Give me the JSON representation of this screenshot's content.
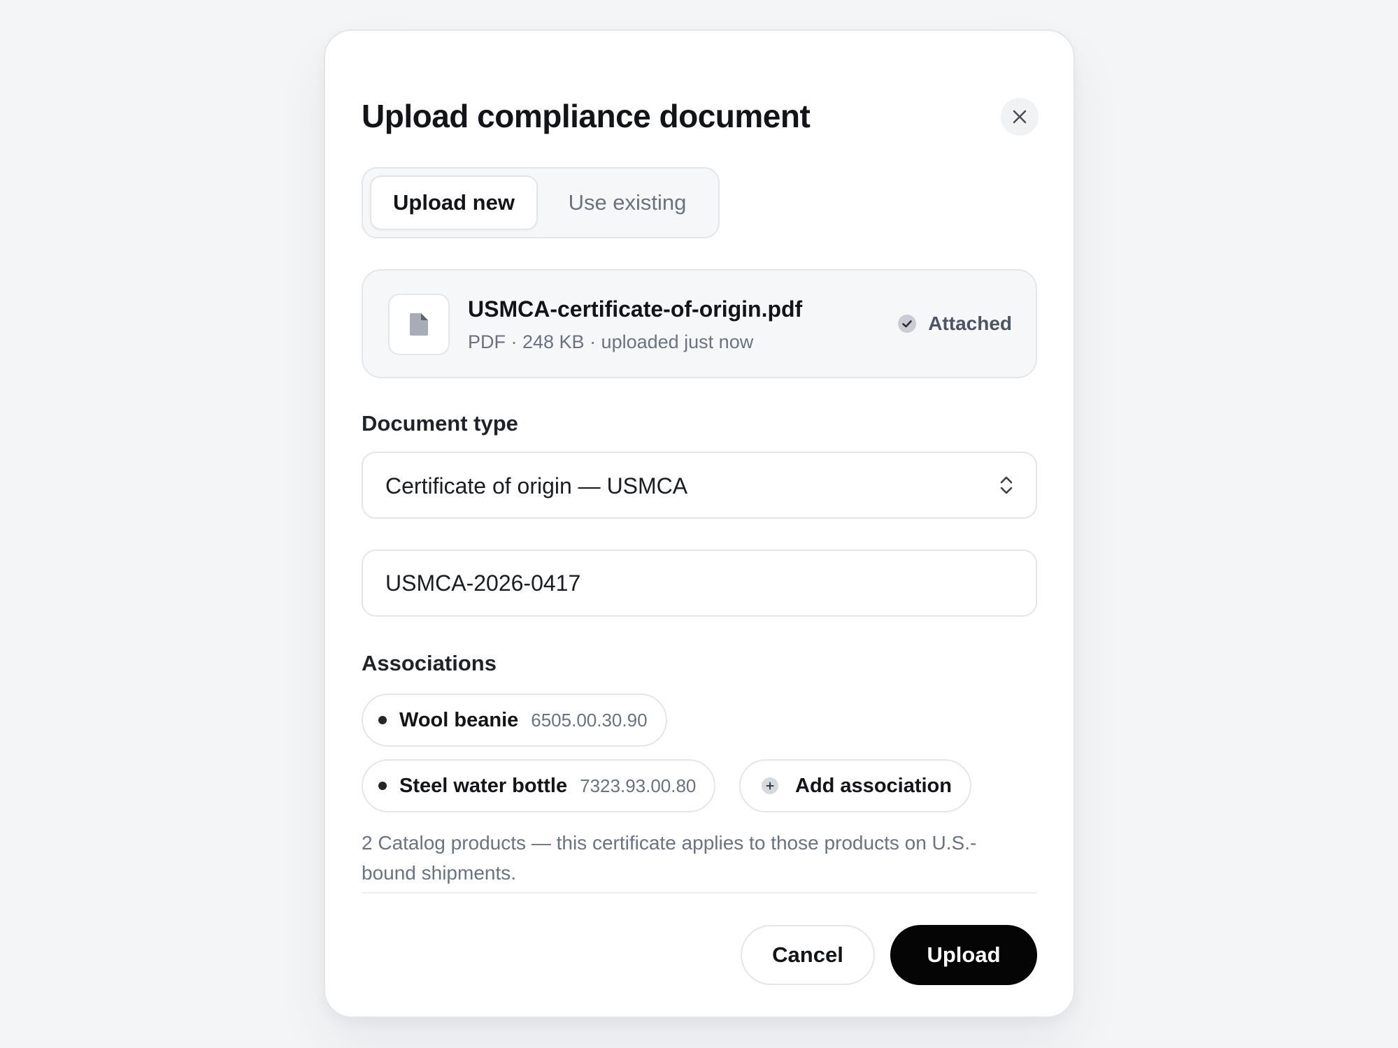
{
  "modal": {
    "title": "Upload compliance document",
    "close_label": "×"
  },
  "tabs": [
    {
      "label": "Upload new",
      "active": true
    },
    {
      "label": "Use existing",
      "active": false
    }
  ],
  "file": {
    "name": "USMCA-certificate-of-origin.pdf",
    "meta": "PDF · 248 KB · uploaded just now",
    "status": "Attached",
    "icon": "file-icon"
  },
  "document_type": {
    "label": "Document type",
    "selected": "Certificate of origin — USMCA"
  },
  "reference": {
    "value": "USMCA-2026-0417"
  },
  "associations": {
    "label": "Associations",
    "items": [
      {
        "name": "Wool beanie",
        "code": "6505.00.30.90"
      },
      {
        "name": "Steel water bottle",
        "code": "7323.93.00.80"
      }
    ],
    "add_label": "Add association",
    "help": "2 Catalog products — this certificate applies to those products on U.S.-bound shipments."
  },
  "actions": {
    "cancel": "Cancel",
    "upload": "Upload"
  },
  "colors": {
    "primary": "#050505",
    "background": "#f4f5f7",
    "muted_text": "#6b7280",
    "border": "#e4e6ea"
  }
}
